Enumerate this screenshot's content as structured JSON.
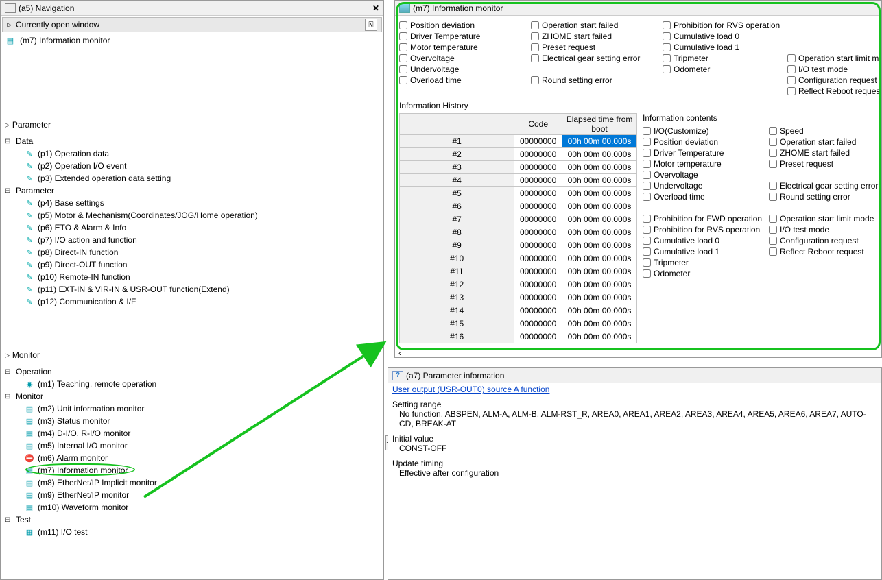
{
  "nav": {
    "title": "(a5) Navigation",
    "open_window": "Currently open window",
    "open_item": "(m7) Information monitor",
    "parameter_label": "Parameter",
    "monitor_label": "Monitor",
    "data_label": "Data",
    "param_group_label": "Parameter",
    "operation_label": "Operation",
    "monitor_group_label": "Monitor",
    "test_label": "Test",
    "data_items": [
      "(p1) Operation data",
      "(p2) Operation I/O event",
      "(p3) Extended operation data setting"
    ],
    "param_items": [
      "(p4) Base settings",
      "(p5) Motor & Mechanism(Coordinates/JOG/Home operation)",
      "(p6) ETO & Alarm & Info",
      "(p7) I/O action and function",
      "(p8) Direct-IN function",
      "(p9) Direct-OUT function",
      "(p10) Remote-IN function",
      "(p11) EXT-IN & VIR-IN & USR-OUT function(Extend)",
      "(p12) Communication & I/F"
    ],
    "operation_items": [
      "(m1) Teaching, remote operation"
    ],
    "monitor_items": [
      "(m2) Unit information monitor",
      "(m3) Status monitor",
      "(m4) D-I/O, R-I/O monitor",
      "(m5) Internal I/O monitor",
      "(m6) Alarm monitor",
      "(m7) Information monitor",
      "(m8) EtherNet/IP Implicit monitor",
      "(m9) EtherNet/IP monitor",
      "(m10) Waveform monitor"
    ],
    "test_items": [
      "(m11) I/O test"
    ]
  },
  "info": {
    "title": "(m7) Information monitor",
    "history_title": "Information History",
    "checks_col1": [
      "Position deviation",
      "Driver Temperature",
      "Motor temperature",
      "Overvoltage",
      "Undervoltage",
      "Overload time"
    ],
    "checks_col2": [
      "Operation start failed",
      "ZHOME start failed",
      "Preset request",
      "Electrical gear setting error",
      "",
      "Round setting error"
    ],
    "checks_col3": [
      "Prohibition for RVS operation",
      "Cumulative load 0",
      "Cumulative load 1",
      "Tripmeter",
      "Odometer",
      ""
    ],
    "checks_col4": [
      "",
      "",
      "",
      "Operation start limit mode",
      "I/O test mode",
      "Configuration request",
      "Reflect Reboot request"
    ],
    "table": {
      "headers": [
        "",
        "Code",
        "Elapsed time from boot"
      ],
      "rows": [
        {
          "n": "#1",
          "code": "00000000",
          "time": "00h 00m 00.000s",
          "sel": true
        },
        {
          "n": "#2",
          "code": "00000000",
          "time": "00h 00m 00.000s"
        },
        {
          "n": "#3",
          "code": "00000000",
          "time": "00h 00m 00.000s"
        },
        {
          "n": "#4",
          "code": "00000000",
          "time": "00h 00m 00.000s"
        },
        {
          "n": "#5",
          "code": "00000000",
          "time": "00h 00m 00.000s"
        },
        {
          "n": "#6",
          "code": "00000000",
          "time": "00h 00m 00.000s"
        },
        {
          "n": "#7",
          "code": "00000000",
          "time": "00h 00m 00.000s"
        },
        {
          "n": "#8",
          "code": "00000000",
          "time": "00h 00m 00.000s"
        },
        {
          "n": "#9",
          "code": "00000000",
          "time": "00h 00m 00.000s"
        },
        {
          "n": "#10",
          "code": "00000000",
          "time": "00h 00m 00.000s"
        },
        {
          "n": "#11",
          "code": "00000000",
          "time": "00h 00m 00.000s"
        },
        {
          "n": "#12",
          "code": "00000000",
          "time": "00h 00m 00.000s"
        },
        {
          "n": "#13",
          "code": "00000000",
          "time": "00h 00m 00.000s"
        },
        {
          "n": "#14",
          "code": "00000000",
          "time": "00h 00m 00.000s"
        },
        {
          "n": "#15",
          "code": "00000000",
          "time": "00h 00m 00.000s"
        },
        {
          "n": "#16",
          "code": "00000000",
          "time": "00h 00m 00.000s"
        }
      ]
    },
    "contents_title": "Information contents",
    "contents_col1_a": [
      "I/O(Customize)",
      "Position deviation",
      "Driver Temperature",
      "Motor temperature",
      "Overvoltage",
      "Undervoltage",
      "Overload time"
    ],
    "contents_col1_b": [
      "Prohibition for FWD operation",
      "Prohibition for RVS operation",
      "Cumulative load 0",
      "Cumulative load 1",
      "Tripmeter",
      "Odometer"
    ],
    "contents_col2_a": [
      "Speed",
      "Operation start failed",
      "ZHOME start failed",
      "Preset request",
      "",
      "Electrical gear setting error",
      "Round setting error"
    ],
    "contents_col2_b": [
      "Operation start limit mode",
      "I/O test mode",
      "Configuration request",
      "Reflect Reboot request"
    ]
  },
  "paraminfo": {
    "title": "(a7) Parameter information",
    "link": "User output (USR-OUT0) source A function",
    "sr_label": "Setting range",
    "sr_val": "No function, ABSPEN, ALM-A, ALM-B, ALM-RST_R, AREA0, AREA1, AREA2, AREA3, AREA4, AREA5, AREA6, AREA7, AUTO-CD, BREAK-AT",
    "iv_label": "Initial value",
    "iv_val": "CONST-OFF",
    "ut_label": "Update timing",
    "ut_val": "Effective after configuration"
  }
}
